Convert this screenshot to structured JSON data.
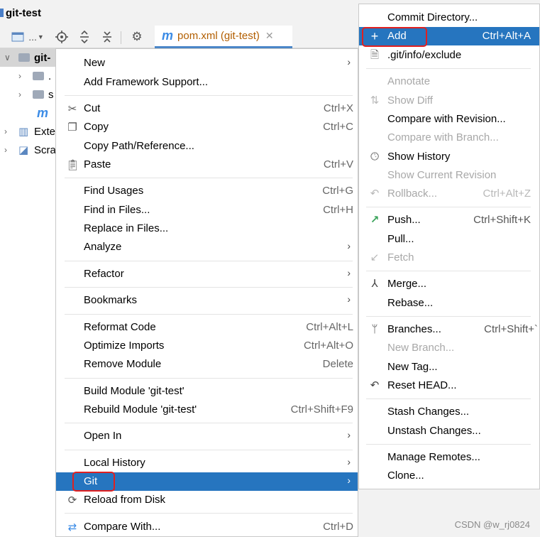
{
  "title_bar": {
    "title": "git-test"
  },
  "toolbar": {
    "view_dropdown": "...",
    "icons": [
      "panel-icon",
      "chevron-down-icon",
      "crosshair-icon",
      "expand-all-icon",
      "collapse-all-icon",
      "gear-icon"
    ]
  },
  "editor_tab": {
    "icon_letter": "m",
    "label": "pom.xml (git-test)",
    "close": "✕"
  },
  "tree": {
    "rows": [
      {
        "label": "git-",
        "expanded": true
      },
      {
        "label": "."
      },
      {
        "label": "s"
      },
      {
        "label": "m"
      },
      {
        "label": "Exte"
      },
      {
        "label": "Scra"
      }
    ]
  },
  "context_menu": {
    "items": [
      {
        "label": "New",
        "submenu": true
      },
      {
        "label": "Add Framework Support..."
      },
      {
        "label": "Cut",
        "shortcut": "Ctrl+X",
        "icon": "scissors-icon"
      },
      {
        "label": "Copy",
        "shortcut": "Ctrl+C",
        "icon": "copy-icon"
      },
      {
        "label": "Copy Path/Reference..."
      },
      {
        "label": "Paste",
        "shortcut": "Ctrl+V",
        "icon": "paste-icon"
      },
      {
        "label": "Find Usages",
        "shortcut": "Ctrl+G"
      },
      {
        "label": "Find in Files...",
        "shortcut": "Ctrl+H"
      },
      {
        "label": "Replace in Files..."
      },
      {
        "label": "Analyze",
        "submenu": true
      },
      {
        "label": "Refactor",
        "submenu": true
      },
      {
        "label": "Bookmarks",
        "submenu": true
      },
      {
        "label": "Reformat Code",
        "shortcut": "Ctrl+Alt+L"
      },
      {
        "label": "Optimize Imports",
        "shortcut": "Ctrl+Alt+O"
      },
      {
        "label": "Remove Module",
        "shortcut": "Delete"
      },
      {
        "label": "Build Module 'git-test'"
      },
      {
        "label": "Rebuild Module 'git-test'",
        "shortcut": "Ctrl+Shift+F9"
      },
      {
        "label": "Open In",
        "submenu": true
      },
      {
        "label": "Local History",
        "submenu": true
      },
      {
        "label": "Git",
        "submenu": true,
        "highlighted": true
      },
      {
        "label": "Reload from Disk",
        "icon": "reload-icon"
      },
      {
        "label": "Compare With...",
        "shortcut": "Ctrl+D",
        "icon": "compare-icon"
      }
    ]
  },
  "git_menu": {
    "items": [
      {
        "label": "Commit Directory..."
      },
      {
        "label": "Add",
        "shortcut": "Ctrl+Alt+A",
        "icon": "plus-icon",
        "highlighted": true
      },
      {
        "label": ".git/info/exclude",
        "icon": "file-exclude-icon"
      },
      {
        "label": "Annotate",
        "disabled": true
      },
      {
        "label": "Show Diff",
        "disabled": true,
        "icon": "diff-icon"
      },
      {
        "label": "Compare with Revision..."
      },
      {
        "label": "Compare with Branch...",
        "disabled": true
      },
      {
        "label": "Show History",
        "icon": "history-icon"
      },
      {
        "label": "Show Current Revision",
        "disabled": true
      },
      {
        "label": "Rollback...",
        "shortcut": "Ctrl+Alt+Z",
        "disabled": true,
        "icon": "undo-icon"
      },
      {
        "label": "Push...",
        "shortcut": "Ctrl+Shift+K",
        "icon": "push-arrow-icon"
      },
      {
        "label": "Pull..."
      },
      {
        "label": "Fetch",
        "disabled": true,
        "icon": "fetch-arrow-icon"
      },
      {
        "label": "Merge...",
        "icon": "merge-icon"
      },
      {
        "label": "Rebase..."
      },
      {
        "label": "Branches...",
        "shortcut": "Ctrl+Shift+`",
        "icon": "branch-icon"
      },
      {
        "label": "New Branch...",
        "disabled": true
      },
      {
        "label": "New Tag..."
      },
      {
        "label": "Reset HEAD...",
        "icon": "undo-icon"
      },
      {
        "label": "Stash Changes..."
      },
      {
        "label": "Unstash Changes..."
      },
      {
        "label": "Manage Remotes..."
      },
      {
        "label": "Clone..."
      }
    ]
  },
  "watermark": "CSDN @w_rj0824",
  "colors": {
    "highlight": "#2675bf",
    "annotation_red": "#e02020",
    "tab_underline": "#4a86c8"
  }
}
